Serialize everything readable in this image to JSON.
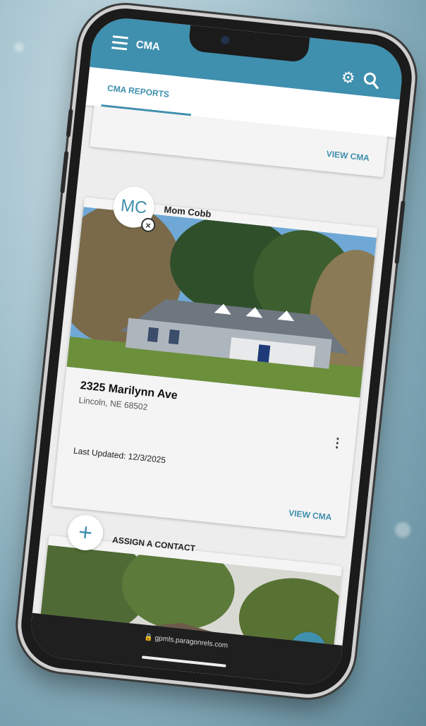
{
  "app": {
    "title": "CMA"
  },
  "tabs": [
    {
      "label": "CMA REPORTS",
      "active": true
    }
  ],
  "cards": [
    {
      "view_link": "VIEW CMA"
    },
    {
      "contact_initials": "MC",
      "contact_name": "Mom Cobb",
      "address": "2325 Marilynn Ave",
      "city_state_zip": "Lincoln, NE 68502",
      "last_updated": "Last Updated: 12/3/2025",
      "view_link": "VIEW CMA"
    },
    {
      "assign_label": "ASSIGN A CONTACT"
    }
  ],
  "browser": {
    "url": "gpmls.paragonrels.com"
  },
  "icons": {
    "menu": "hamburger-menu-icon",
    "settings": "gear-icon",
    "search": "search-icon",
    "remove_contact": "close-circle-icon",
    "more": "more-vert-icon",
    "add_contact": "plus-icon",
    "fab": "plus-icon",
    "lock": "lock-icon"
  },
  "colors": {
    "accent": "#3f8fae",
    "card_bg": "#f4f4f4"
  }
}
